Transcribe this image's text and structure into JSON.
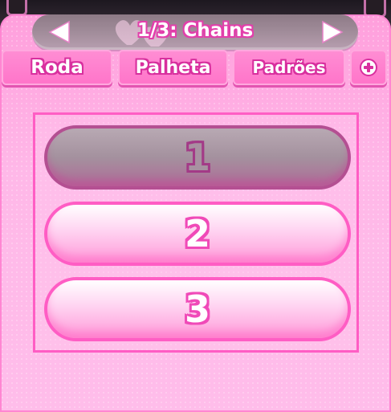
{
  "pager": {
    "title": "1/3: Chains",
    "prev_icon": "triangle-left-icon",
    "next_icon": "triangle-right-icon"
  },
  "tabs": [
    {
      "label": "Roda"
    },
    {
      "label": "Palheta"
    },
    {
      "label": "Padrões"
    }
  ],
  "add_tab": {
    "icon": "plus-icon"
  },
  "slots": [
    {
      "label": "1",
      "selected": true
    },
    {
      "label": "2",
      "selected": false
    },
    {
      "label": "3",
      "selected": false
    }
  ],
  "colors": {
    "panel": "#ffb6e6",
    "accent": "#ff5dc4",
    "tab": "#ff74c9",
    "selected_slot": "#a4919e"
  }
}
